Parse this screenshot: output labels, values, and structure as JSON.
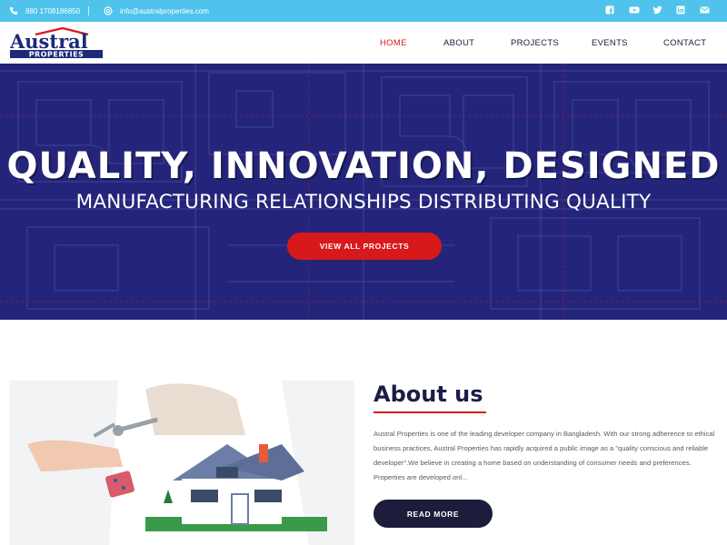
{
  "topbar": {
    "phone": "880 1708186850",
    "email": "info@australproperties.com",
    "social": [
      "facebook-icon",
      "youtube-icon",
      "twitter-icon",
      "linkedin-icon",
      "email-icon"
    ]
  },
  "logo": {
    "line1": "Austral",
    "line2": "PROPERTIES"
  },
  "nav": {
    "home": "HOME",
    "about": "ABOUT",
    "projects": "PROJECTS",
    "events": "EVENTS",
    "contact": "CONTACT"
  },
  "hero": {
    "title": "QUALITY, INNOVATION, DESIGNED",
    "subtitle": "MANUFACTURING RELATIONSHIPS DISTRIBUTING QUALITY",
    "button": "VIEW ALL PROJECTS"
  },
  "about": {
    "title": "About us",
    "text": "Austral Properties is one of the leading developer company in Bangladesh. With our strong adherence to ethical business practices, Austral Properties has rapidly acquired a public image as a \"quality conscious and reliable developer\".We believe in creating a home based on understanding of consumer needs and preferences. Properties are developed onl...",
    "button": "READ MORE"
  },
  "colors": {
    "topbar": "#4fc3ec",
    "accent": "#d7191c",
    "navy": "#1c1d45",
    "hero_bg": "#24257a"
  }
}
